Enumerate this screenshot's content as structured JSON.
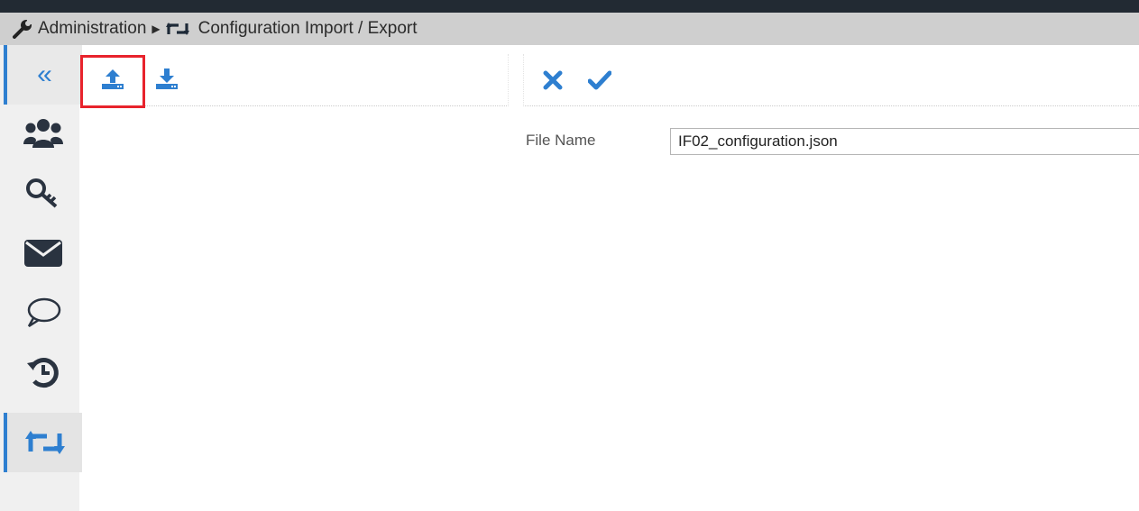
{
  "breadcrumb": {
    "admin_label": "Administration",
    "current_label": "Configuration Import / Export",
    "icons": [
      "wrench-icon",
      "exchange-icon"
    ]
  },
  "sidebar": {
    "items": [
      {
        "name": "collapse",
        "icon": "double-chevron-left-icon",
        "glyph": "«"
      },
      {
        "name": "users",
        "icon": "users-icon"
      },
      {
        "name": "keys",
        "icon": "key-icon"
      },
      {
        "name": "mail",
        "icon": "envelope-icon"
      },
      {
        "name": "messages",
        "icon": "speech-bubble-icon"
      },
      {
        "name": "history",
        "icon": "history-icon"
      },
      {
        "name": "import-export",
        "icon": "exchange-icon",
        "active": true
      }
    ]
  },
  "toolbar": {
    "left_buttons": [
      "upload-icon",
      "download-icon"
    ],
    "right_buttons": [
      "cancel-icon",
      "confirm-icon"
    ]
  },
  "form": {
    "file_name_label": "File Name",
    "file_name_value": "IF02_configuration.json"
  },
  "colors": {
    "accent": "#2e7fd0",
    "icon_dark": "#2a3340",
    "highlight": "#e8232c",
    "breadcrumb_bg": "#cfcfcf",
    "topbar": "#222a33"
  }
}
